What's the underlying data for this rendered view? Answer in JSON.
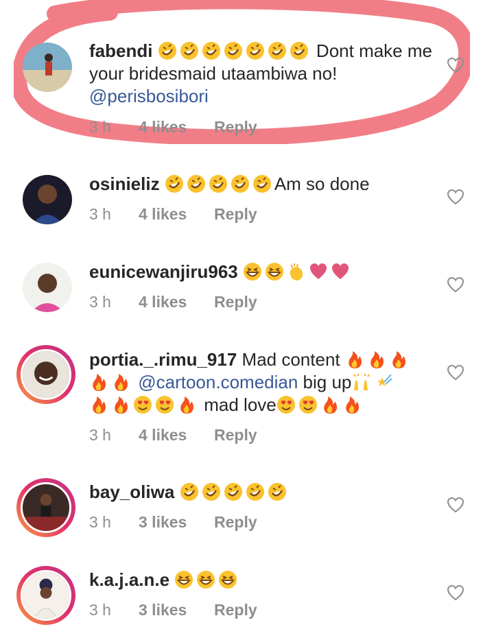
{
  "comments": [
    {
      "username": "fabendi",
      "text": "Dont make me your bridesmaid utaambiwa no!",
      "mention": "@perisbosibori",
      "time": "3 h",
      "likes": "4 likes",
      "reply": "Reply",
      "emojis": [
        "rofl-emoji",
        "rofl-emoji",
        "rofl-emoji",
        "rofl-emoji",
        "rofl-emoji",
        "rofl-emoji",
        "rofl-emoji"
      ]
    },
    {
      "username": "osinieliz",
      "text": "Am so done",
      "time": "3 h",
      "likes": "4 likes",
      "reply": "Reply"
    },
    {
      "username": "eunicewanjiru963",
      "time": "3 h",
      "likes": "4 likes",
      "reply": "Reply"
    },
    {
      "username": "portia._.rimu_917",
      "text1": "Mad content",
      "mention": "@cartoon.comedian",
      "text2": "big up",
      "text3": "mad love",
      "time": "3 h",
      "likes": "4 likes",
      "reply": "Reply"
    },
    {
      "username": "bay_oliwa",
      "time": "3 h",
      "likes": "3 likes",
      "reply": "Reply"
    },
    {
      "username": "k.a.j.a.n.e",
      "time": "3 h",
      "likes": "3 likes",
      "reply": "Reply"
    }
  ],
  "colors": {
    "highlight": "#f0707a",
    "mention": "#385898",
    "meta": "#8e8e8e",
    "emoji": "#f9c22e",
    "fire": "#f4511e",
    "heart_emoji": "#e2557a"
  }
}
